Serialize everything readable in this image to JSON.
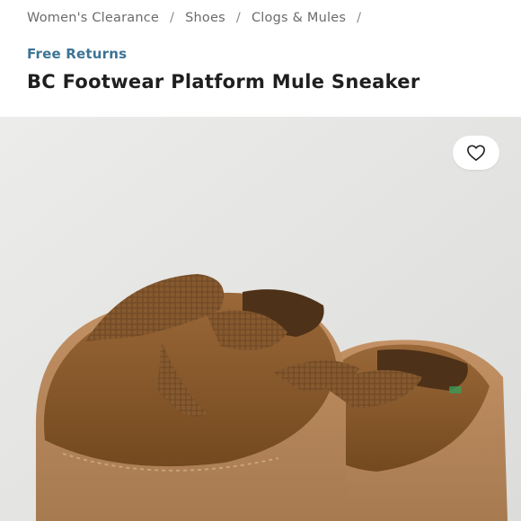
{
  "breadcrumb": {
    "items": [
      {
        "label": "Women's Clearance"
      },
      {
        "label": "Shoes"
      },
      {
        "label": "Clogs & Mules"
      }
    ],
    "separator": "/"
  },
  "product": {
    "promo": "Free Returns",
    "title": "BC Footwear Platform Mule Sneaker"
  },
  "gallery": {
    "favorite_icon": "heart-outline-icon",
    "image": "brown-suede-platform-mule-sneakers-with-laces"
  },
  "colors": {
    "promo": "#3c7496",
    "suede": "#8a5a30",
    "sole": "#b8845a",
    "background": "#e6e6e4"
  }
}
